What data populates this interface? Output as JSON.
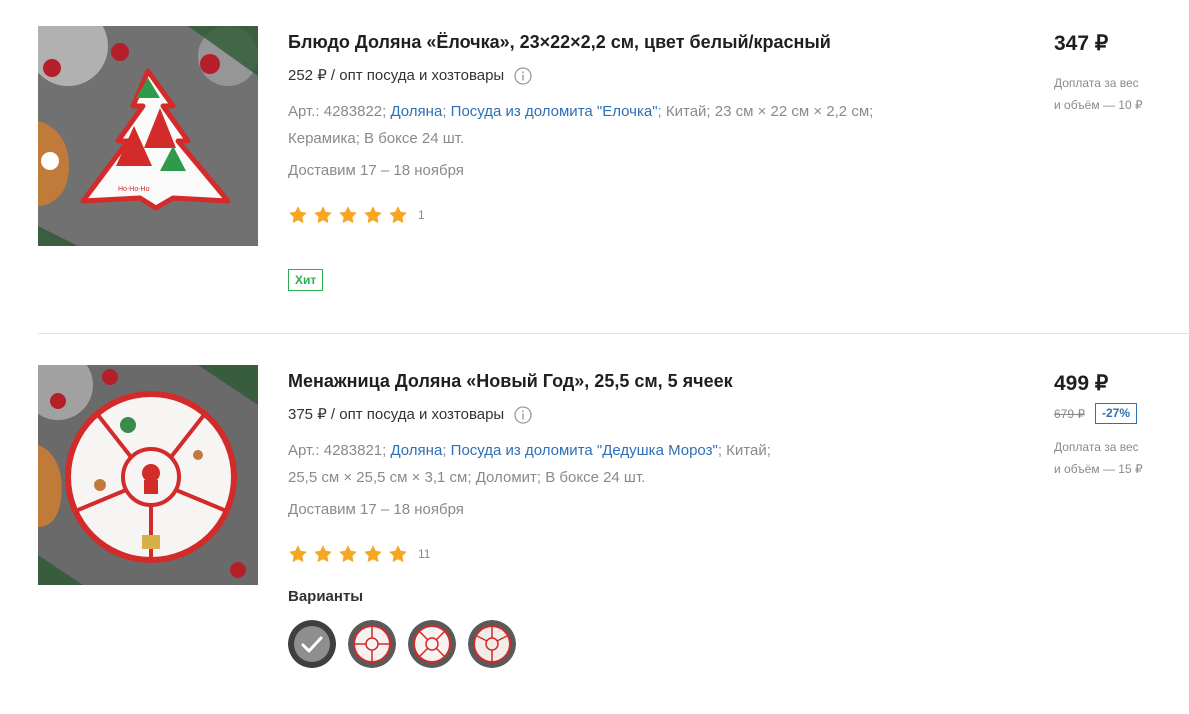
{
  "products": [
    {
      "title": "Блюдо Доляна «Ёлочка», 23×22×2,2 см, цвет белый/красный",
      "wholesale": "252 ₽ / опт посуда и хозтовары",
      "art": "Арт.: 4283822;",
      "brand": "Доляна",
      "collection": "Посуда из доломита \"Елочка\"",
      "country": "Китай;",
      "dims": "23 см × 22 см × 2,2 см;",
      "material": "Керамика;",
      "box": "В боксе 24 шт.",
      "delivery": "Доставим 17 – 18 ноября",
      "rating_value": 5,
      "reviews": "1",
      "badge": "Хит",
      "price": "347 ₽",
      "surcharge_line1": "Доплата за вес",
      "surcharge_line2": "и объём — 10 ₽"
    },
    {
      "title": "Менажница Доляна «Новый Год», 25,5 см, 5 ячеек",
      "wholesale": "375 ₽ / опт посуда и хозтовары",
      "art": "Арт.: 4283821;",
      "brand": "Доляна",
      "collection": "Посуда из доломита \"Дедушка Мороз\"",
      "country": "Китай;",
      "dims": "25,5 см × 25,5 см × 3,1 см;",
      "material": "Доломит;",
      "box": "В боксе 24 шт.",
      "delivery": "Доставим 17 – 18 ноября",
      "rating_value": 5,
      "reviews": "11",
      "variants_label": "Варианты",
      "variants_count": 4,
      "selected_variant": 1,
      "price": "499 ₽",
      "old_price": "679 ₽",
      "discount": "-27%",
      "surcharge_line1": "Доплата за вес",
      "surcharge_line2": "и объём — 15 ₽"
    }
  ],
  "icons": {
    "info": "info-icon",
    "star": "star-icon",
    "check": "check-icon"
  },
  "colors": {
    "link": "#2f6fb6",
    "star": "#f5a623",
    "hit_badge": "#2fae4e",
    "discount": "#2f6fb6",
    "muted": "#8a8a8a"
  }
}
